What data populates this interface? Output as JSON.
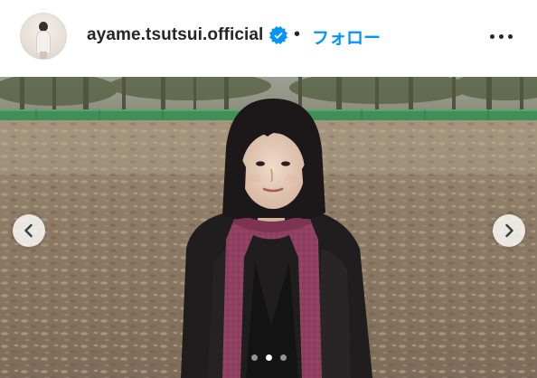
{
  "header": {
    "username": "ayame.tsutsui.official",
    "separator": "•",
    "follow_label": "フォロー",
    "avatar_icon": "profile-avatar",
    "verified_icon": "verified-badge-icon",
    "more_icon": "more-options-icon"
  },
  "carousel": {
    "prev_icon": "chevron-left-icon",
    "next_icon": "chevron-right-icon",
    "slide_count": 3,
    "active_slide": 2
  },
  "colors": {
    "link_blue": "#0095f6",
    "text_dark": "#262626",
    "verified_blue": "#0095f6"
  }
}
